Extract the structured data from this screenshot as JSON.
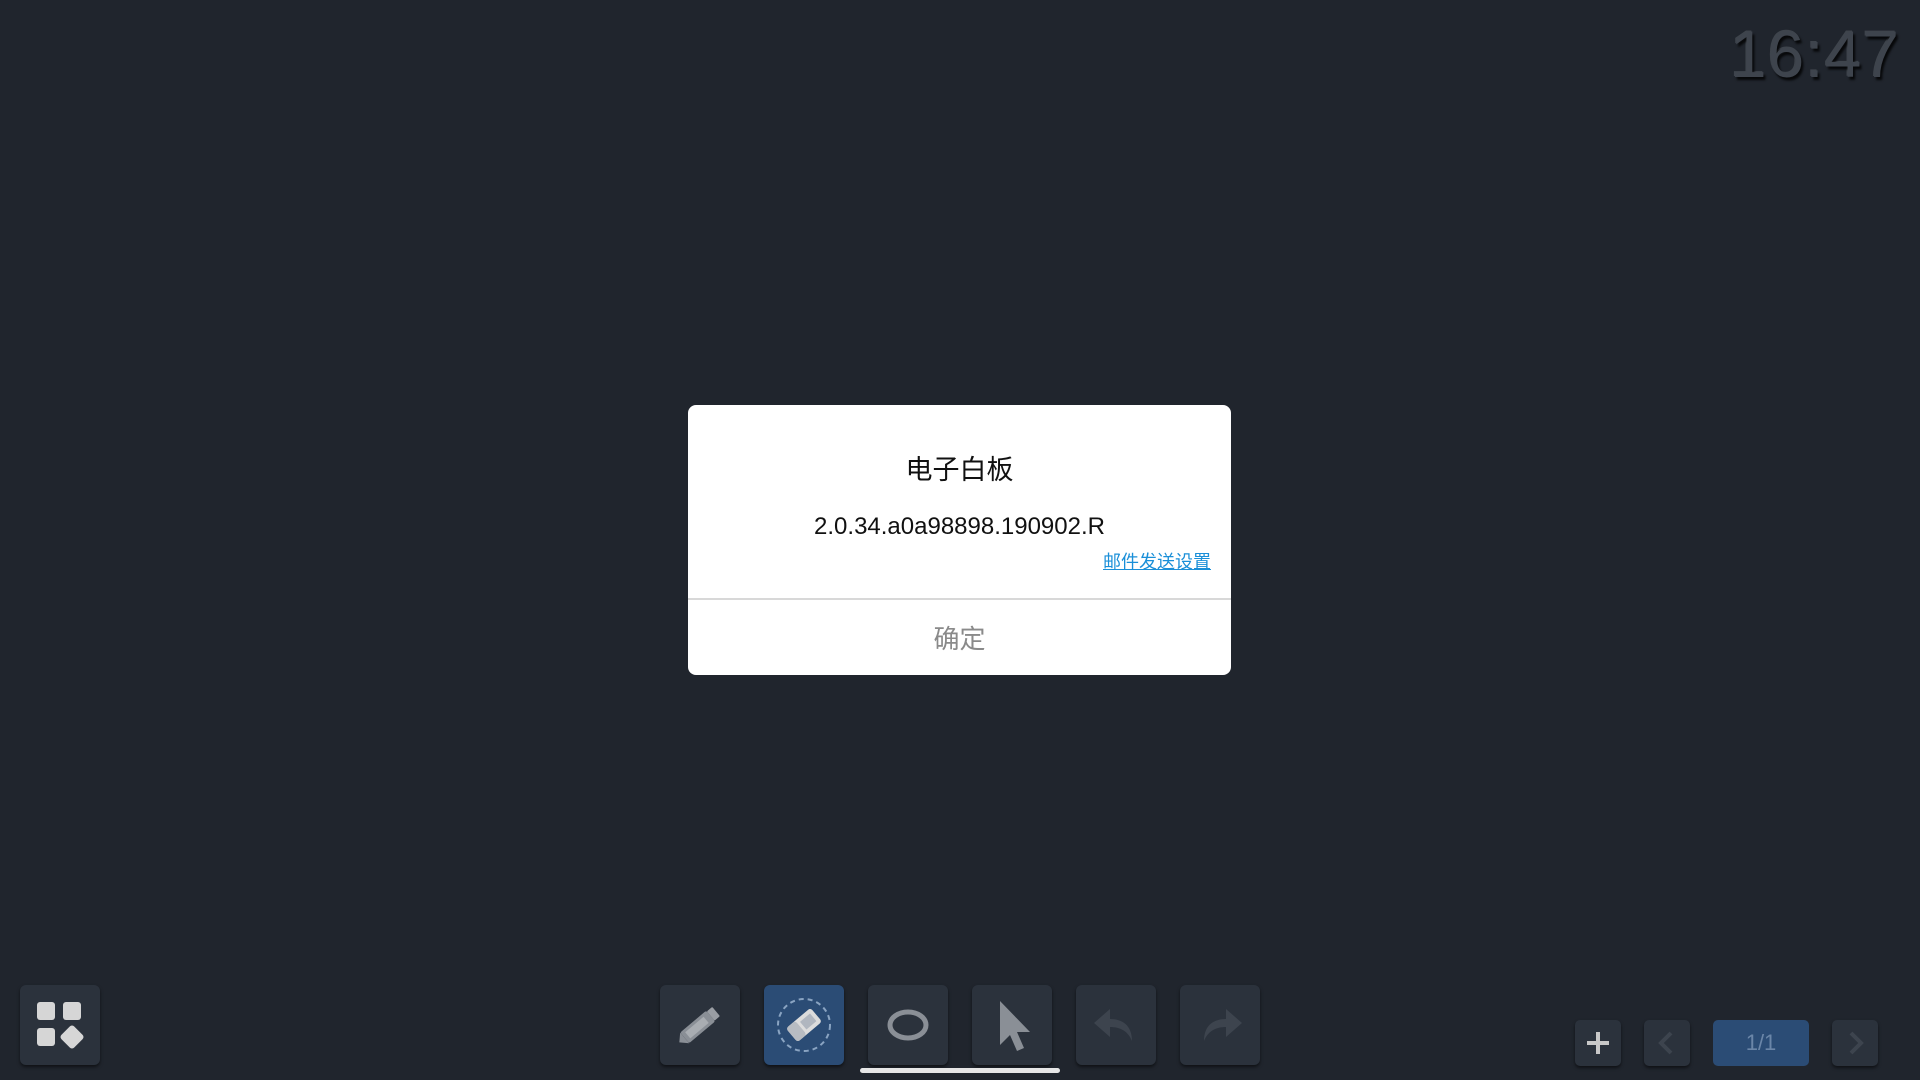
{
  "status": {
    "clock": "16:47"
  },
  "dialog": {
    "title": "电子白板",
    "version": "2.0.34.a0a98898.190902.R",
    "link": "邮件发送设置",
    "confirm": "确定"
  },
  "toolbar": {
    "tools": [
      {
        "name": "pen",
        "icon": "pen-icon",
        "active": false
      },
      {
        "name": "eraser",
        "icon": "eraser-icon",
        "active": true
      },
      {
        "name": "shape",
        "icon": "ellipse-icon",
        "active": false
      },
      {
        "name": "select",
        "icon": "cursor-icon",
        "active": false
      },
      {
        "name": "undo",
        "icon": "undo-icon",
        "active": false
      },
      {
        "name": "redo",
        "icon": "redo-icon",
        "active": false
      }
    ]
  },
  "pagination": {
    "indicator": "1/1"
  },
  "colors": {
    "background": "#20252d",
    "button": "#2b323c",
    "active_button": "#2b4c75",
    "link": "#1a8fd8"
  }
}
